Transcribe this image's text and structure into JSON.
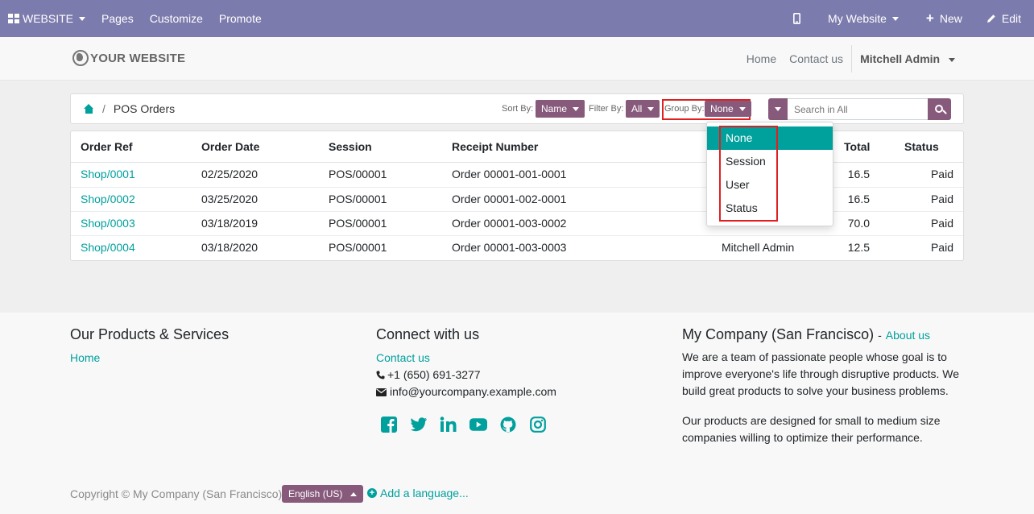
{
  "topbar": {
    "app_menu": "WEBSITE",
    "pages": "Pages",
    "customize": "Customize",
    "promote": "Promote",
    "website_switcher": "My Website",
    "new": "New",
    "edit": "Edit"
  },
  "header": {
    "logo_text": "YOUR WEBSITE",
    "nav_home": "Home",
    "nav_contact": "Contact us",
    "user": "Mitchell Admin"
  },
  "toolbar": {
    "breadcrumb_page": "POS Orders",
    "sort_label": "Sort By:",
    "sort_value": "Name",
    "filter_label": "Filter By:",
    "filter_value": "All",
    "group_label": "Group By:",
    "group_value": "None",
    "search_placeholder": "Search in All"
  },
  "group_by_dropdown": {
    "options": [
      "None",
      "Session",
      "User",
      "Status"
    ],
    "selected": "None"
  },
  "table": {
    "columns": [
      "Order Ref",
      "Order Date",
      "Session",
      "Receipt Number",
      "Total",
      "Status"
    ],
    "rows": [
      {
        "ref": "Shop/0001",
        "date": "02/25/2020",
        "session": "POS/00001",
        "receipt": "Order 00001-001-0001",
        "user": "",
        "total": "16.5",
        "status": "Paid"
      },
      {
        "ref": "Shop/0002",
        "date": "03/25/2020",
        "session": "POS/00001",
        "receipt": "Order 00001-002-0001",
        "user": "",
        "total": "16.5",
        "status": "Paid"
      },
      {
        "ref": "Shop/0003",
        "date": "03/18/2019",
        "session": "POS/00001",
        "receipt": "Order 00001-003-0002",
        "user": "",
        "total": "70.0",
        "status": "Paid"
      },
      {
        "ref": "Shop/0004",
        "date": "03/18/2020",
        "session": "POS/00001",
        "receipt": "Order 00001-003-0003",
        "user": "Mitchell Admin",
        "total": "12.5",
        "status": "Paid"
      }
    ]
  },
  "footer": {
    "products_title": "Our Products & Services",
    "products_home": "Home",
    "connect_title": "Connect with us",
    "connect_contact": "Contact us",
    "phone": "+1 (650) 691-3277",
    "email": "info@yourcompany.example.com",
    "social_icons": [
      "facebook-icon",
      "twitter-icon",
      "linkedin-icon",
      "youtube-icon",
      "github-icon",
      "instagram-icon"
    ],
    "company_title": "My Company (San Francisco)",
    "company_dash": "-",
    "about_link": "About us",
    "about_p1": "We are a team of passionate people whose goal is to improve everyone's life through disruptive products. We build great products to solve your business problems.",
    "about_p2": "Our products are designed for small to medium size companies willing to optimize their performance.",
    "copyright": "Copyright © My Company (San Francisco)",
    "language": "English (US)",
    "add_language": "Add a language..."
  },
  "colors": {
    "topbar": "#7c7bad",
    "accent": "#00a09d",
    "pill": "#875a7b",
    "highlight": "#e02020"
  }
}
